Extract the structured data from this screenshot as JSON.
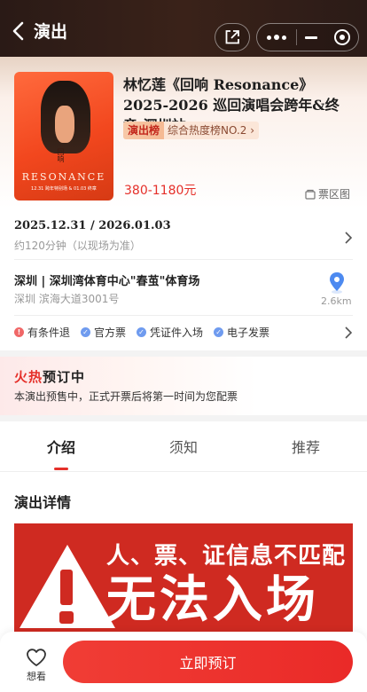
{
  "nav": {
    "title": "演出"
  },
  "event": {
    "title": "林忆莲《回响 Resonance》 2025-2026 巡回演唱会跨年&终章-深圳站",
    "rank_tag": "演出榜",
    "rank_value": "综合热度榜NO.2",
    "price": "380-1180元",
    "seat_map": "票区图",
    "poster": {
      "word": "RESONANCE",
      "sub": "12.31 跨年特别场 & 01.03 终章",
      "cn": "回响"
    }
  },
  "schedule": {
    "date": "2025.12.31 / 2026.01.03",
    "duration": "约120分钟（以现场为准）"
  },
  "venue": {
    "name": "深圳 | 深圳湾体育中心\"春茧\"体育场",
    "address": "深圳 滨海大道3001号",
    "distance": "2.6km"
  },
  "service_tags": [
    {
      "label": "有条件退",
      "type": "warn"
    },
    {
      "label": "官方票",
      "type": "ok"
    },
    {
      "label": "凭证件入场",
      "type": "ok"
    },
    {
      "label": "电子发票",
      "type": "ok"
    }
  ],
  "presale": {
    "title_hot": "火热",
    "title_rest": "预订中",
    "description": "本演出预售中，正式开票后将第一时间为您配票"
  },
  "tabs": [
    {
      "label": "介绍",
      "active": true
    },
    {
      "label": "须知",
      "active": false
    },
    {
      "label": "推荐",
      "active": false
    }
  ],
  "detail": {
    "section_title": "演出详情",
    "banner_line1": "人、票、证信息不匹配",
    "banner_line2": "无法入场"
  },
  "bottom": {
    "want_label": "想看",
    "buy_label": "立即预订"
  },
  "colors": {
    "accent": "#e5302a",
    "nav_bg": "#2a1a16",
    "banner_red": "#cf2a21"
  }
}
